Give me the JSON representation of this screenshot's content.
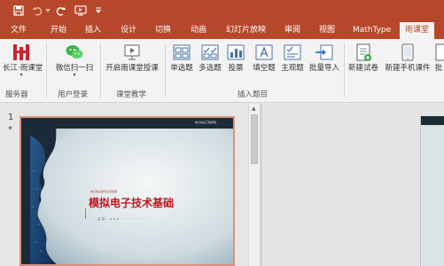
{
  "app": {
    "accent": "#b7472a",
    "quick_access": [
      {
        "icon": "save-icon"
      },
      {
        "icon": "undo-icon"
      },
      {
        "icon": "undo-dropdown-icon"
      },
      {
        "icon": "redo-icon"
      },
      {
        "icon": "from-beginning-icon"
      },
      {
        "icon": "customize-qat-icon"
      }
    ]
  },
  "tabs": [
    "文件",
    "开始",
    "插入",
    "设计",
    "切换",
    "动画",
    "幻灯片放映",
    "审阅",
    "视图",
    "MathType",
    "雨课堂"
  ],
  "active_tab": "雨课堂",
  "ribbon": {
    "groups": [
      {
        "label": "服务器",
        "buttons": [
          {
            "label": "长江·雨课堂",
            "icon": "yuketang-logo-icon",
            "caret": "▾"
          }
        ]
      },
      {
        "label": "用户登录",
        "buttons": [
          {
            "label": "微信扫一扫",
            "icon": "wechat-icon",
            "caret": "▾"
          }
        ]
      },
      {
        "label": "课堂教学",
        "buttons": [
          {
            "label": "开启雨课堂授课",
            "icon": "start-class-icon"
          }
        ]
      },
      {
        "label": "插入题目",
        "buttons": [
          {
            "label": "单选题",
            "icon": "single-choice-icon"
          },
          {
            "label": "多选题",
            "icon": "multiple-choice-icon"
          },
          {
            "label": "投票",
            "icon": "vote-icon"
          },
          {
            "label": "填空题",
            "icon": "fill-blank-icon"
          },
          {
            "label": "主观题",
            "icon": "subjective-icon"
          },
          {
            "label": "批量导入",
            "icon": "batch-import-icon"
          }
        ]
      },
      {
        "label": "",
        "buttons": [
          {
            "label": "新建试卷",
            "icon": "new-paper-icon"
          },
          {
            "label": "新建手机课件",
            "icon": "new-mobile-courseware-icon"
          },
          {
            "label": "批",
            "icon": "truncated-icon"
          }
        ]
      }
    ]
  },
  "slides": [
    {
      "number": "1",
      "marker": "*",
      "title": "模拟电子技术基础",
      "caption": "电子信息类专业基础课",
      "top_text": "电子信息工程学院",
      "subtitle": "主讲：×××   ·  ·  ·  ·  ·  ·  ·"
    }
  ]
}
